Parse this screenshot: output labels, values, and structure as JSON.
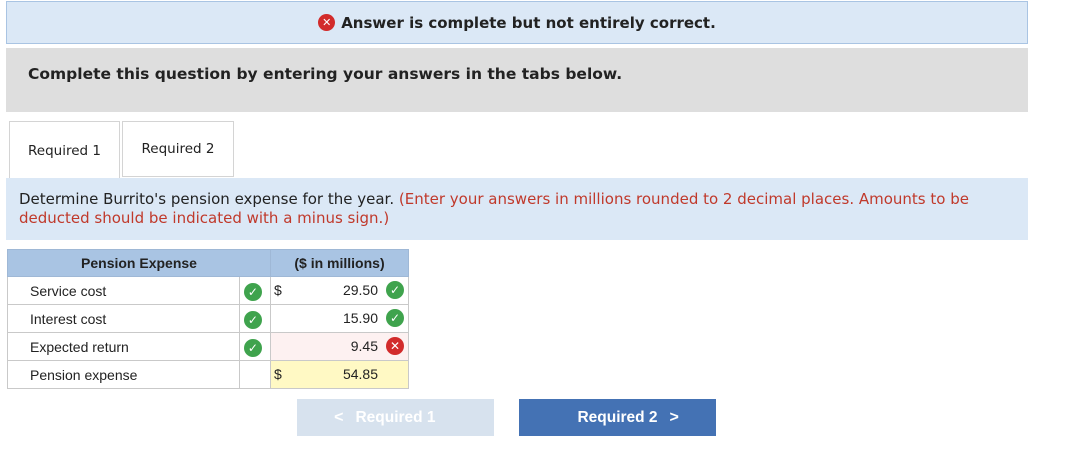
{
  "banner": {
    "text": "Answer is complete but not entirely correct.",
    "icon": "x-circle-icon"
  },
  "instruction": "Complete this question by entering your answers in the tabs below.",
  "tabs": [
    {
      "label": "Required 1",
      "active": true
    },
    {
      "label": "Required 2",
      "active": false
    }
  ],
  "question": {
    "text": "Determine Burrito's pension expense for the year.",
    "note": "(Enter your answers in millions rounded to 2 decimal places. Amounts to be deducted should be indicated with a minus sign.)"
  },
  "table": {
    "headers": [
      "Pension Expense",
      "($ in millions)"
    ],
    "rows": [
      {
        "label": "Service cost",
        "label_status": "correct",
        "currency": "$",
        "value": "29.50",
        "value_status": "correct"
      },
      {
        "label": "Interest cost",
        "label_status": "correct",
        "currency": "",
        "value": "15.90",
        "value_status": "correct"
      },
      {
        "label": "Expected return",
        "label_status": "correct",
        "currency": "",
        "value": "9.45",
        "value_status": "incorrect"
      },
      {
        "label": "Pension expense",
        "label_status": "",
        "currency": "$",
        "value": "54.85",
        "value_status": ""
      }
    ]
  },
  "nav": {
    "prev_label": "Required 1",
    "prev_chevron": "<",
    "next_label": "Required 2",
    "next_chevron": ">"
  },
  "colors": {
    "correct": "#3fa34d",
    "incorrect": "#d22b2b",
    "header_bg": "#a9c4e3",
    "next_button": "#4472b4"
  }
}
